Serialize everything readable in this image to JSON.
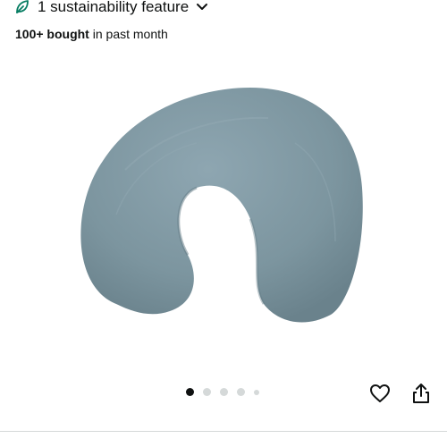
{
  "sustainability": {
    "label": "1 sustainability feature",
    "icon": "leaf-icon",
    "accent_color": "#067d62"
  },
  "purchase_stat": {
    "bold": "100+ bought",
    "rest": " in past month"
  },
  "product_image": {
    "alt": "Nursing pillow",
    "color": "#7f98a3"
  },
  "carousel": {
    "count": 5,
    "active_index": 0
  },
  "actions": {
    "favorite_icon": "heart-icon",
    "share_icon": "share-icon"
  }
}
